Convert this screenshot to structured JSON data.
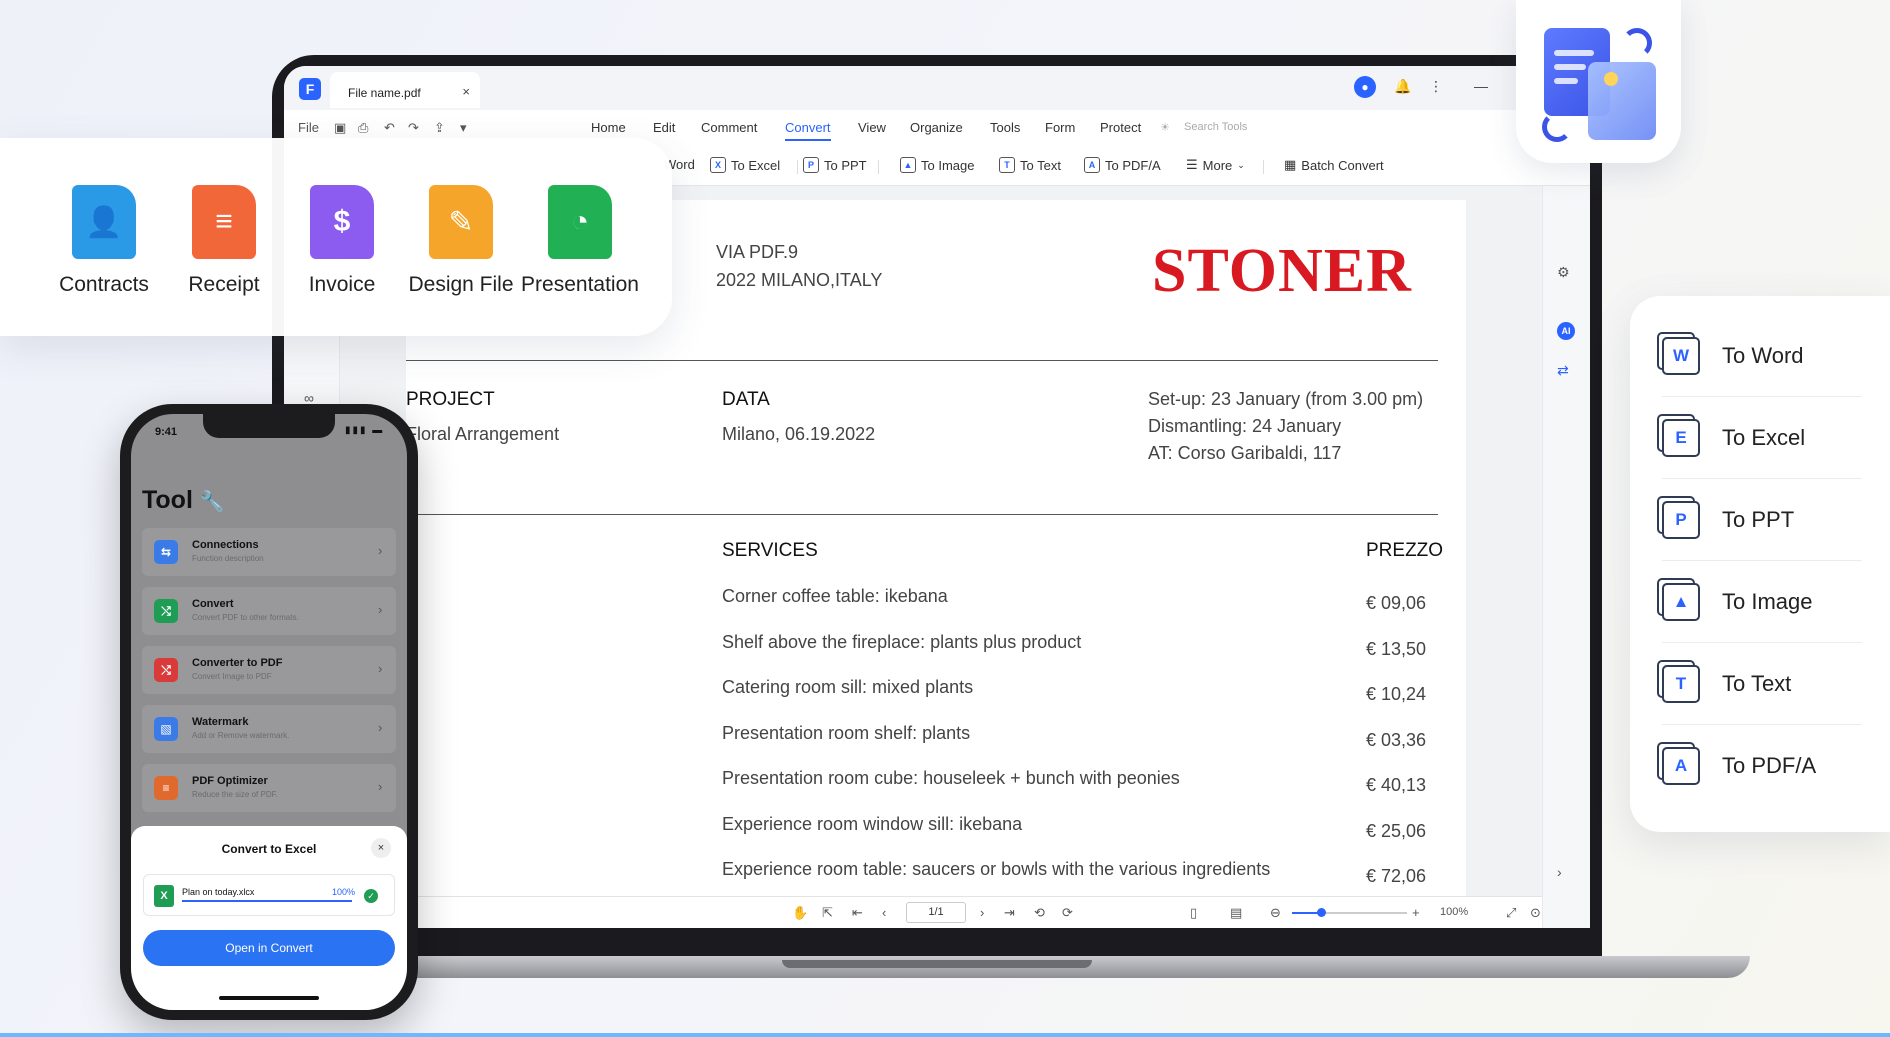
{
  "titlebar": {
    "file_tab": "File name.pdf",
    "close": "×"
  },
  "quickbar": {
    "file": "File",
    "menu": [
      "Home",
      "Edit",
      "Comment",
      "Convert",
      "View",
      "Organize",
      "Tools",
      "Form",
      "Protect"
    ],
    "active_menu": "Convert",
    "search_placeholder": "Search Tools"
  },
  "subbar": {
    "items": [
      "Word",
      "To Excel",
      "To PPT",
      "To Image",
      "To Text",
      "To PDF/A",
      "More",
      "Batch Convert"
    ]
  },
  "document": {
    "address_line1": "VIA PDF.9",
    "address_line2": "2022 MILANO,ITALY",
    "brand": "STONER",
    "project_label": "PROJECT",
    "project_value": "Floral Arrangement",
    "data_label": "DATA",
    "data_value": "Milano, 06.19.2022",
    "setup": "Set-up: 23 January (from 3.00 pm)",
    "dismantling": "Dismantling: 24 January",
    "location": "AT: Corso Garibaldi, 117",
    "services_label": "SERVICES",
    "price_label": "PREZZO",
    "services": [
      {
        "name": "Corner coffee table: ikebana",
        "price": "€ 09,06"
      },
      {
        "name": "Shelf above the fireplace: plants plus product",
        "price": "€ 13,50"
      },
      {
        "name": "Catering room sill: mixed plants",
        "price": "€ 10,24"
      },
      {
        "name": "Presentation room shelf: plants",
        "price": "€ 03,36"
      },
      {
        "name": "Presentation room cube: houseleek + bunch with peonies",
        "price": "€ 40,13"
      },
      {
        "name": "Experience room window sill: ikebana",
        "price": "€ 25,06"
      },
      {
        "name": "Experience room table: saucers or bowls with the various ingredients",
        "price": "€ 72,06"
      }
    ]
  },
  "statusbar": {
    "page": "1/1",
    "zoom": "100%",
    "zoom_level": 0.25
  },
  "templates": [
    {
      "label": "Contracts",
      "color": "#2b9ae6"
    },
    {
      "label": "Receipt",
      "color": "#f2673a"
    },
    {
      "label": "Invoice",
      "color": "#8c5cf0"
    },
    {
      "label": "Design File",
      "color": "#f5a62a"
    },
    {
      "label": "Presentation",
      "color": "#22b055"
    }
  ],
  "convert_panel": [
    {
      "letter": "W",
      "label": "To Word"
    },
    {
      "letter": "E",
      "label": "To Excel"
    },
    {
      "letter": "P",
      "label": "To PPT"
    },
    {
      "letter": "▲",
      "label": "To Image"
    },
    {
      "letter": "T",
      "label": "To Text"
    },
    {
      "letter": "A",
      "label": "To PDF/A"
    }
  ],
  "phone": {
    "time": "9:41",
    "title": "Tool",
    "rows": [
      {
        "title": "Connections",
        "sub": "Function description",
        "color": "#3b7be8"
      },
      {
        "title": "Convert",
        "sub": "Convert PDF to other formats.",
        "color": "#1f9d55"
      },
      {
        "title": "Converter to PDF",
        "sub": "Convert Image to PDF",
        "color": "#d93a3a"
      },
      {
        "title": "Watermark",
        "sub": "Add or Remove watermark.",
        "color": "#3b7be8"
      },
      {
        "title": "PDF Optimizer",
        "sub": "Reduce the size of PDF.",
        "color": "#e0692d"
      }
    ],
    "sheet_title": "Convert to Excel",
    "file_name": "Plan on today.xlcx",
    "file_progress": "100%",
    "open_button": "Open in Convert"
  }
}
